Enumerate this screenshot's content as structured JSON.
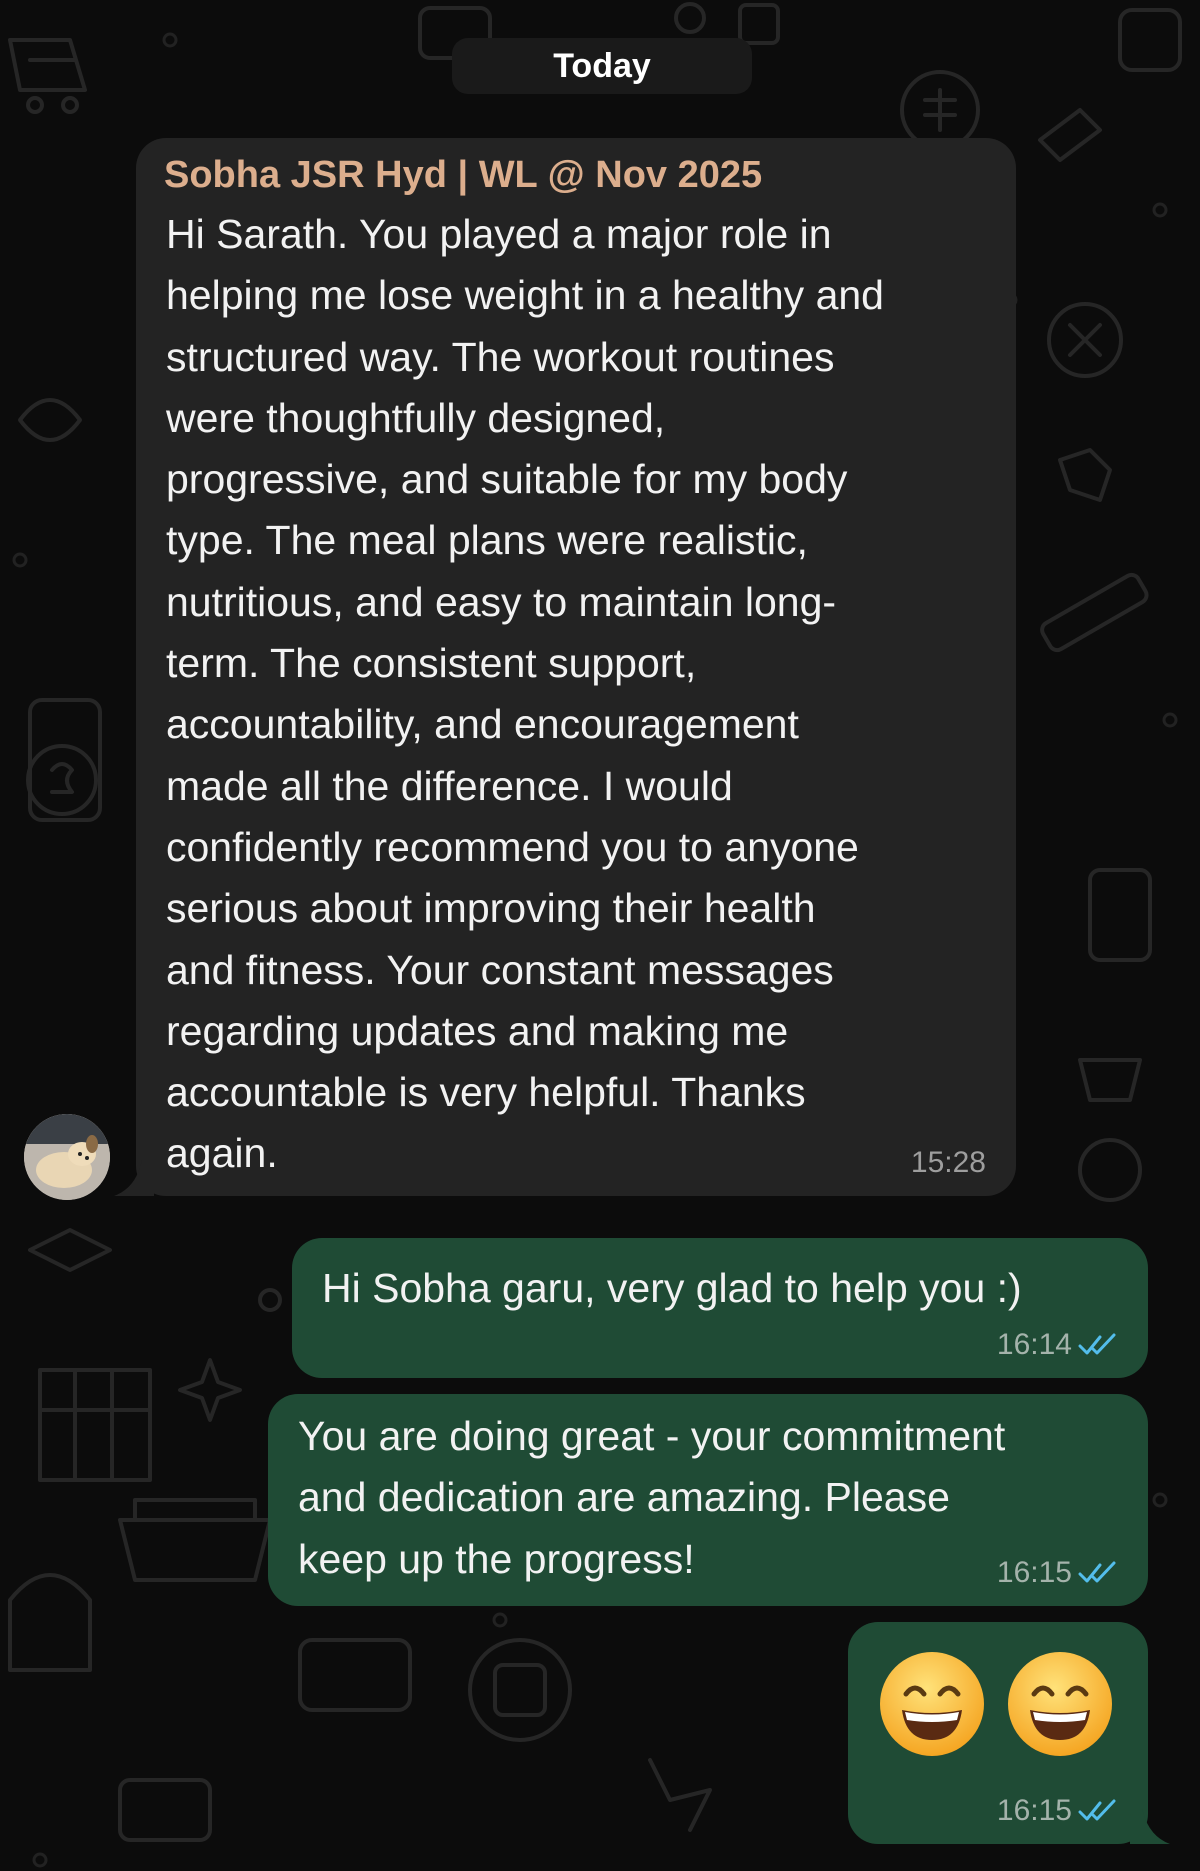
{
  "chat": {
    "date_label": "Today",
    "colors": {
      "background": "#0c0c0c",
      "incoming_bubble": "#232323",
      "outgoing_bubble": "#1f4b35",
      "sender_name": "#dcae8d",
      "read_ticks": "#53bdeb"
    }
  },
  "incoming": {
    "sender": "Sobha JSR Hyd | WL @ Nov 2025",
    "text": "Hi Sarath. You played a major role in\nhelping me lose weight in a healthy and\nstructured way. The workout routines\nwere thoughtfully designed,\nprogressive, and suitable for my body\ntype. The meal plans were realistic,\nnutritious, and easy to maintain long-\nterm. The consistent support,\naccountability, and encouragement\nmade all the difference. I would\nconfidently recommend you to anyone\nserious about improving their health\nand fitness. Your constant messages\nregarding updates and making me\naccountable is very helpful. Thanks\nagain.",
    "time": "15:28",
    "avatar_icon": "puppy-avatar"
  },
  "outgoing": [
    {
      "text": "Hi Sobha garu, very glad to help you :)",
      "time": "16:14",
      "status": "read"
    },
    {
      "text": "You are doing great - your commitment\nand dedication are amazing. Please\nkeep up the progress!",
      "time": "16:15",
      "status": "read"
    },
    {
      "emoji": [
        "😄",
        "😄"
      ],
      "emoji_name": "grinning-face-with-smiling-eyes",
      "time": "16:15",
      "status": "read"
    }
  ]
}
